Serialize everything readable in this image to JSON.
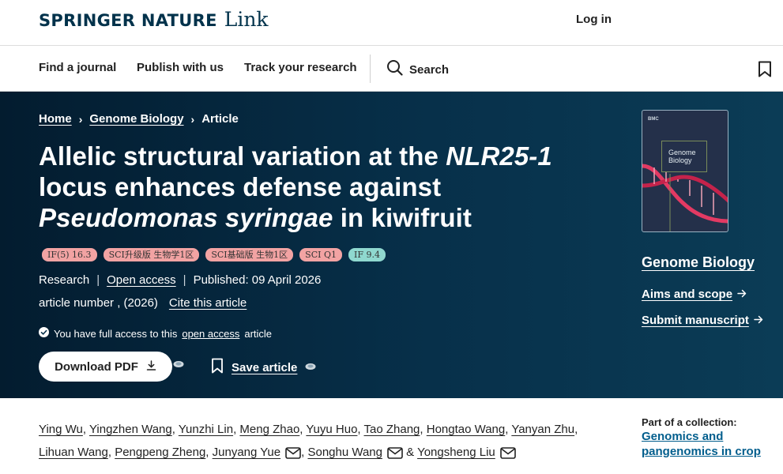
{
  "header": {
    "logo_brand": "SPRINGER NATURE",
    "logo_product": "Link",
    "login": "Log in"
  },
  "nav": {
    "items": [
      "Find a journal",
      "Publish with us",
      "Track your research"
    ],
    "search_label": "Search"
  },
  "breadcrumb": [
    "Home",
    "Genome Biology",
    "Article"
  ],
  "article": {
    "title_part1": "Allelic structural variation at the ",
    "title_italic1": "NLR25-1",
    "title_part2": " locus enhances defense against ",
    "title_italic2": "Pseudomonas syringae",
    "title_part3": " in kiwifruit",
    "badges": [
      {
        "text": "IF(5) 16.3",
        "color": "#f2a3a3"
      },
      {
        "text": "SCI升级版 生物学1区",
        "color": "#f2a3a3"
      },
      {
        "text": "SCI基础版 生物1区",
        "color": "#f2a3a3"
      },
      {
        "text": "SCI Q1",
        "color": "#f2a3a3"
      },
      {
        "text": "IF 9.4",
        "color": "#8fd8cf"
      }
    ],
    "type": "Research",
    "access_link": "Open access",
    "published": "Published: 09 April 2026",
    "article_number": "article number , (2026)",
    "cite_link": "Cite this article",
    "access_note_pre": "You have full access to this",
    "access_note_link": "open access",
    "access_note_post": "article",
    "download_label": "Download PDF",
    "save_label": "Save article"
  },
  "journal": {
    "cover_publisher": "BMC",
    "cover_title_line1": "Genome",
    "cover_title_line2": "Biology",
    "name": "Genome Biology",
    "aims_link": "Aims and scope",
    "submit_link": "Submit manuscript"
  },
  "authors": [
    {
      "name": "Ying Wu",
      "email": false
    },
    {
      "name": "Yingzhen Wang",
      "email": false
    },
    {
      "name": "Yunzhi Lin",
      "email": false
    },
    {
      "name": "Meng Zhao",
      "email": false
    },
    {
      "name": "Yuyu Huo",
      "email": false
    },
    {
      "name": "Tao Zhang",
      "email": false
    },
    {
      "name": "Hongtao Wang",
      "email": false
    },
    {
      "name": "Yanyan Zhu",
      "email": false
    },
    {
      "name": "Lihuan Wang",
      "email": false
    },
    {
      "name": "Pengpeng Zheng",
      "email": false
    },
    {
      "name": "Junyang Yue",
      "email": true
    },
    {
      "name": "Songhu Wang",
      "email": true
    },
    {
      "name": "Yongsheng Liu",
      "email": true
    }
  ],
  "collection": {
    "label": "Part of a collection:",
    "link": "Genomics and pangenomics in crop domestication"
  },
  "colors": {
    "hero_bg": "#07304a",
    "brand": "#01324b",
    "link_blue": "#025e8d"
  }
}
